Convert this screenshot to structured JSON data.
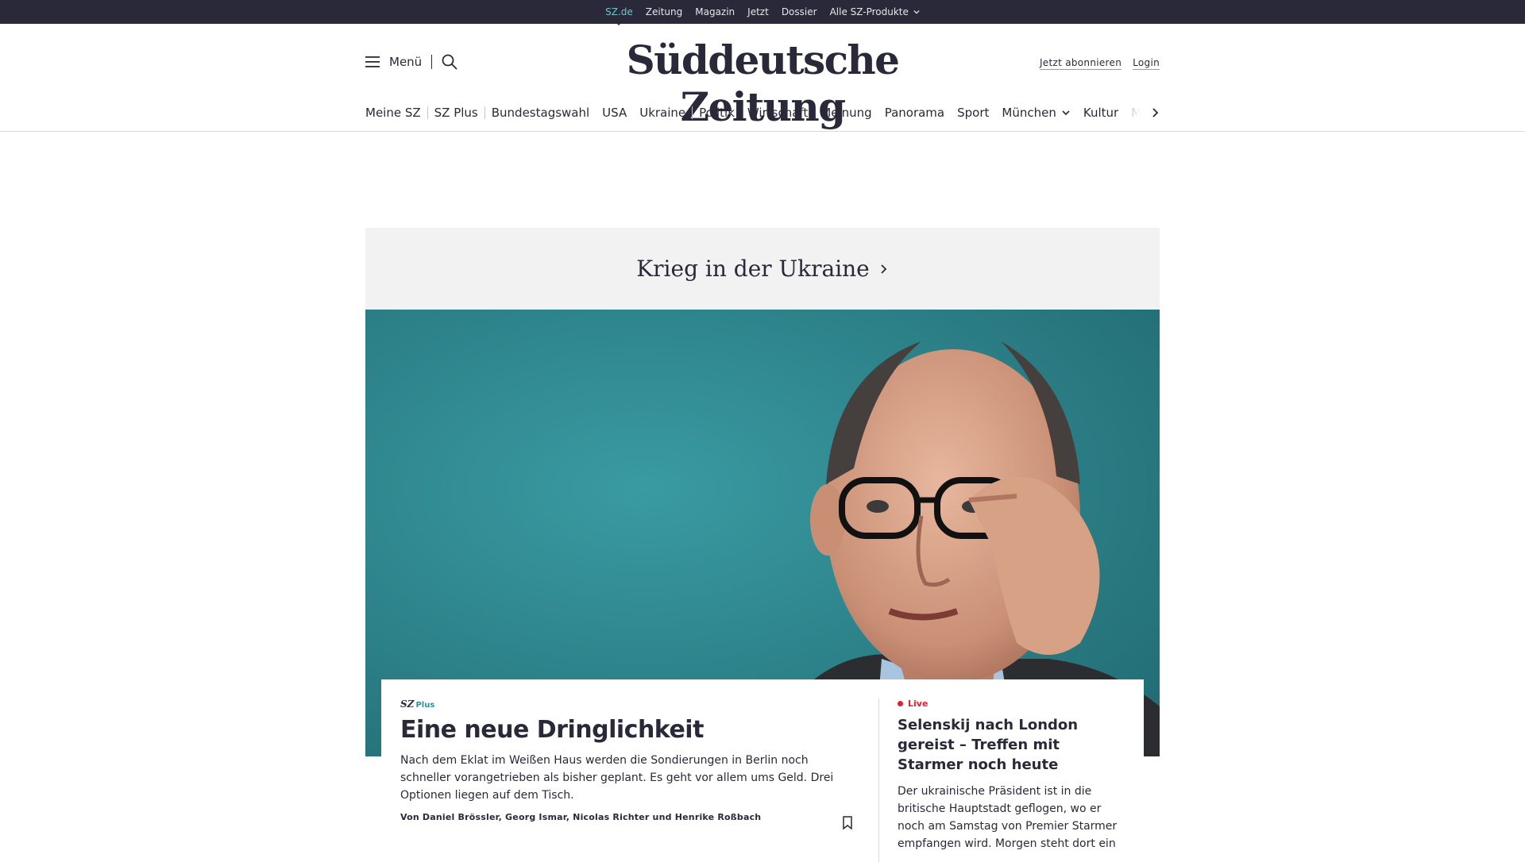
{
  "topbar": {
    "items": [
      {
        "label": "SZ.de",
        "active": true
      },
      {
        "label": "Zeitung"
      },
      {
        "label": "Magazin"
      },
      {
        "label": "Jetzt"
      },
      {
        "label": "Dossier"
      },
      {
        "label": "Alle SZ-Produkte",
        "icon": "chevron-down-icon"
      }
    ]
  },
  "header": {
    "menu_label": "Menü",
    "logo": "Süddeutsche Zeitung",
    "subscribe_label": "Jetzt abonnieren",
    "login_label": "Login"
  },
  "nav": {
    "items": [
      "Meine SZ",
      "SZ Plus",
      "Bundestagswahl",
      "USA",
      "Ukraine",
      "Politik",
      "Wirtschaft",
      "Meinung",
      "Panorama",
      "Sport",
      "München",
      "Kultur",
      "M"
    ]
  },
  "topic_banner": {
    "title": "Krieg in der Ukraine"
  },
  "lead_article": {
    "badge_sz": "SZ",
    "badge_plus": "Plus",
    "title": "Eine neue Dringlichkeit",
    "teaser": "Nach dem Eklat im Weißen Haus werden die Sondierungen in Berlin noch schneller vorangetrieben als bisher geplant. Es geht vor allem ums Geld. Drei Optionen liegen auf dem Tisch.",
    "authors": "Von Daniel Brössler, Georg Ismar, Nicolas Richter und Henrike Roßbach"
  },
  "live_article": {
    "badge": "Live",
    "title": "Selenskij nach London gereist – Treffen mit Starmer noch heute",
    "teaser": "Der ukrainische Präsident ist in die britische Hauptstadt geflogen, wo er noch am Samstag von Premier Starmer empfangen wird. Morgen steht dort ein"
  },
  "colors": {
    "brand_dark": "#29293a",
    "accent_teal": "#2e8f97",
    "live_red": "#e2202e"
  }
}
